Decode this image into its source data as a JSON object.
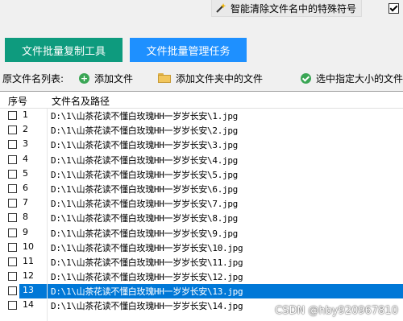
{
  "top_option": {
    "label": "智能清除文件名中的特殊符号",
    "icon": "magic-wand-icon",
    "checked": true
  },
  "buttons": {
    "copy_tool": "文件批量复制工具",
    "manage_task": "文件批量管理任务"
  },
  "toolbar": {
    "list_label": "原文件名列表:",
    "add_file": "添加文件",
    "add_folder": "添加文件夹中的文件",
    "select_size": "选中指定大小的文件"
  },
  "table": {
    "headers": [
      "序号",
      "文件名及路径"
    ],
    "rows": [
      {
        "num": "1",
        "path": "D:\\1\\山茶花读不懂白玫瑰HH一岁岁长安\\1.jpg"
      },
      {
        "num": "2",
        "path": "D:\\1\\山茶花读不懂白玫瑰HH一岁岁长安\\2.jpg"
      },
      {
        "num": "3",
        "path": "D:\\1\\山茶花读不懂白玫瑰HH一岁岁长安\\3.jpg"
      },
      {
        "num": "4",
        "path": "D:\\1\\山茶花读不懂白玫瑰HH一岁岁长安\\4.jpg"
      },
      {
        "num": "5",
        "path": "D:\\1\\山茶花读不懂白玫瑰HH一岁岁长安\\5.jpg"
      },
      {
        "num": "6",
        "path": "D:\\1\\山茶花读不懂白玫瑰HH一岁岁长安\\6.jpg"
      },
      {
        "num": "7",
        "path": "D:\\1\\山茶花读不懂白玫瑰HH一岁岁长安\\7.jpg"
      },
      {
        "num": "8",
        "path": "D:\\1\\山茶花读不懂白玫瑰HH一岁岁长安\\8.jpg"
      },
      {
        "num": "9",
        "path": "D:\\1\\山茶花读不懂白玫瑰HH一岁岁长安\\9.jpg"
      },
      {
        "num": "10",
        "path": "D:\\1\\山茶花读不懂白玫瑰HH一岁岁长安\\10.jpg"
      },
      {
        "num": "11",
        "path": "D:\\1\\山茶花读不懂白玫瑰HH一岁岁长安\\11.jpg"
      },
      {
        "num": "12",
        "path": "D:\\1\\山茶花读不懂白玫瑰HH一岁岁长安\\12.jpg"
      },
      {
        "num": "13",
        "path": "D:\\1\\山茶花读不懂白玫瑰HH一岁岁长安\\13.jpg"
      },
      {
        "num": "14",
        "path": "D:\\1\\山茶花读不懂白玫瑰HH一岁岁长安\\14.jpg"
      }
    ],
    "selected_row": "13"
  },
  "watermark": "CSDN @hby920967810",
  "colors": {
    "copy_button": "#0e9b7e",
    "manage_button": "#1e90ff",
    "selection": "#0078d7"
  }
}
